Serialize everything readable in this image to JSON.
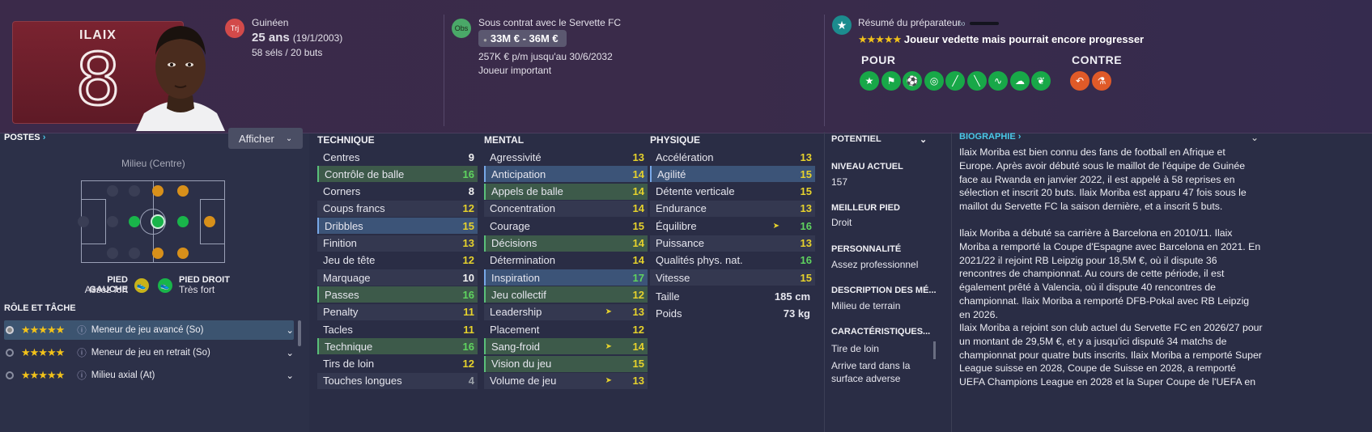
{
  "player": {
    "name": "ILAIX",
    "number": "8"
  },
  "nationality": {
    "icon": "Trj",
    "label": "Guinéen",
    "age": "25 ans",
    "dob": "(19/1/2003)",
    "caps": "58 séls / 20 buts"
  },
  "contract": {
    "icon": "Obs",
    "club": "Sous contrat avec le Servette FC",
    "value": "33M € - 36M €",
    "wage": "257K € p/m jusqu'au 30/6/2032",
    "status": "Joueur important"
  },
  "scout": {
    "title": "Résumé du préparateur",
    "stars": "★★★★★",
    "summary": "Joueur vedette mais pourrait encore progresser",
    "pros_label": "POUR",
    "cons_label": "CONTRE"
  },
  "positions": {
    "title": "POSTES",
    "button": "Afficher",
    "position": "Milieu (Centre)",
    "left_foot_label": "PIED GAUCHE",
    "left_foot": "Assez fort",
    "right_foot_label": "PIED DROIT",
    "right_foot": "Très fort"
  },
  "roles": {
    "title": "RÔLE ET TÂCHE",
    "items": [
      {
        "label": "Meneur de jeu avancé (So)",
        "stars": "★★★★★"
      },
      {
        "label": "Meneur de jeu en retrait (So)",
        "stars": "★★★★★"
      },
      {
        "label": "Milieu axial (At)",
        "stars": "★★★★★"
      }
    ]
  },
  "technique": {
    "title": "TECHNIQUE",
    "rows": [
      {
        "name": "Centres",
        "value": "9"
      },
      {
        "name": "Contrôle de balle",
        "value": "16"
      },
      {
        "name": "Corners",
        "value": "8"
      },
      {
        "name": "Coups francs",
        "value": "12"
      },
      {
        "name": "Dribbles",
        "value": "15"
      },
      {
        "name": "Finition",
        "value": "13"
      },
      {
        "name": "Jeu de tête",
        "value": "12"
      },
      {
        "name": "Marquage",
        "value": "10"
      },
      {
        "name": "Passes",
        "value": "16"
      },
      {
        "name": "Penalty",
        "value": "11"
      },
      {
        "name": "Tacles",
        "value": "11"
      },
      {
        "name": "Technique",
        "value": "16"
      },
      {
        "name": "Tirs de loin",
        "value": "12"
      },
      {
        "name": "Touches longues",
        "value": "4"
      }
    ]
  },
  "mental": {
    "title": "MENTAL",
    "rows": [
      {
        "name": "Agressivité",
        "value": "13"
      },
      {
        "name": "Anticipation",
        "value": "14"
      },
      {
        "name": "Appels de balle",
        "value": "14"
      },
      {
        "name": "Concentration",
        "value": "14"
      },
      {
        "name": "Courage",
        "value": "15"
      },
      {
        "name": "Décisions",
        "value": "14"
      },
      {
        "name": "Détermination",
        "value": "14"
      },
      {
        "name": "Inspiration",
        "value": "17"
      },
      {
        "name": "Jeu collectif",
        "value": "12"
      },
      {
        "name": "Leadership",
        "value": "13"
      },
      {
        "name": "Placement",
        "value": "12"
      },
      {
        "name": "Sang-froid",
        "value": "14"
      },
      {
        "name": "Vision du jeu",
        "value": "15"
      },
      {
        "name": "Volume de jeu",
        "value": "13"
      }
    ]
  },
  "physique": {
    "title": "PHYSIQUE",
    "rows": [
      {
        "name": "Accélération",
        "value": "13"
      },
      {
        "name": "Agilité",
        "value": "15"
      },
      {
        "name": "Détente verticale",
        "value": "15"
      },
      {
        "name": "Endurance",
        "value": "13"
      },
      {
        "name": "Équilibre",
        "value": "16"
      },
      {
        "name": "Puissance",
        "value": "13"
      },
      {
        "name": "Qualités phys. nat.",
        "value": "16"
      },
      {
        "name": "Vitesse",
        "value": "15"
      }
    ],
    "height_label": "Taille",
    "height": "185 cm",
    "weight_label": "Poids",
    "weight": "73 kg"
  },
  "info": {
    "potential": "POTENTIEL",
    "current_level_label": "NIVEAU ACTUEL",
    "current_level": "157",
    "best_foot_label": "MEILLEUR PIED",
    "best_foot": "Droit",
    "personality_label": "PERSONNALITÉ",
    "personality": "Assez professionnel",
    "description_label": "DESCRIPTION DES MÉ...",
    "description": "Milieu de terrain",
    "traits_label": "CARACTÉRISTIQUES...",
    "traits": [
      "Tire de loin",
      "Arrive tard dans la surface adverse"
    ]
  },
  "bio": {
    "title": "BIOGRAPHIE",
    "p1": "Ilaix Moriba est bien connu des fans de football en Afrique et Europe. Après avoir débuté sous le maillot de l'équipe de Guinée face au Rwanda en janvier 2022, il est appelé à 58 reprises en sélection et inscrit 20 buts. Ilaix Moriba est apparu 47 fois sous le maillot du Servette FC la saison dernière, et a inscrit 5 buts.",
    "p2": "Ilaix Moriba a débuté sa carrière à Barcelona en 2010/11. Ilaix Moriba a remporté la Coupe d'Espagne avec Barcelona en 2021. En 2021/22 il rejoint RB Leipzig pour 18,5M €, où il dispute 36 rencontres de championnat. Au cours de cette période, il est également prêté à Valencia, où il dispute 40 rencontres de championnat. Ilaix Moriba a remporté DFB-Pokal avec RB Leipzig en 2026.",
    "p3": "Ilaix Moriba a rejoint son club actuel du Servette FC en 2026/27 pour un montant de 29,5M €, et y a jusqu'ici disputé 34 matchs de championnat pour quatre buts inscrits. Ilaix Moriba a remporté Super League suisse en 2028, Coupe de Suisse en 2028, a remporté UEFA Champions League en 2028 et la Super Coupe de l'UEFA en"
  }
}
